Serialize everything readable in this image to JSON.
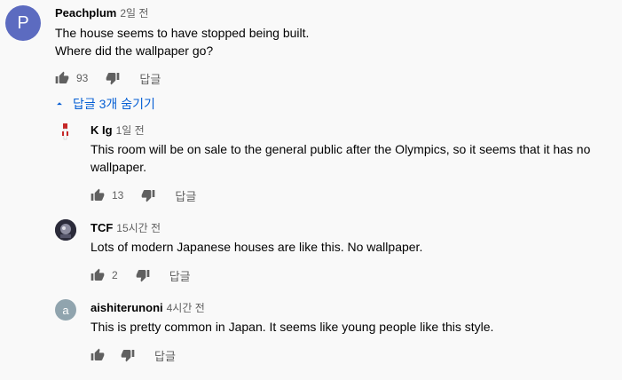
{
  "colors": {
    "background": "#f9f9f9",
    "link_blue": "#065fd4",
    "secondary_text": "#606060",
    "avatar_p": "#5c6bc0",
    "avatar_a": "#90a4ae"
  },
  "top_comment": {
    "avatar_letter": "P",
    "author": "Peachplum",
    "time": "2일 전",
    "text_line1": "The house seems to have stopped being built.",
    "text_line2": "Where did the wallpaper go?",
    "likes": "93",
    "reply_label": "답글",
    "icons": [
      "thumb-up-icon",
      "thumb-down-icon"
    ]
  },
  "hide_replies": {
    "label": "답글 3개 숨기기",
    "icon": "caret-up-icon"
  },
  "replies": [
    {
      "author": "K Ig",
      "time": "1일 전",
      "text": "This room will be on sale to the general public after the Olympics, so it seems that it has no wallpaper.",
      "likes": "13",
      "reply_label": "답글"
    },
    {
      "author": "TCF",
      "time": "15시간 전",
      "text": "Lots of modern Japanese houses are like this. No wallpaper.",
      "likes": "2",
      "reply_label": "답글"
    },
    {
      "avatar_letter": "a",
      "author": "aishiterunoni",
      "time": "4시간 전",
      "text": "This is pretty common in Japan. It seems like young people like this style.",
      "likes": "",
      "reply_label": "답글"
    }
  ]
}
